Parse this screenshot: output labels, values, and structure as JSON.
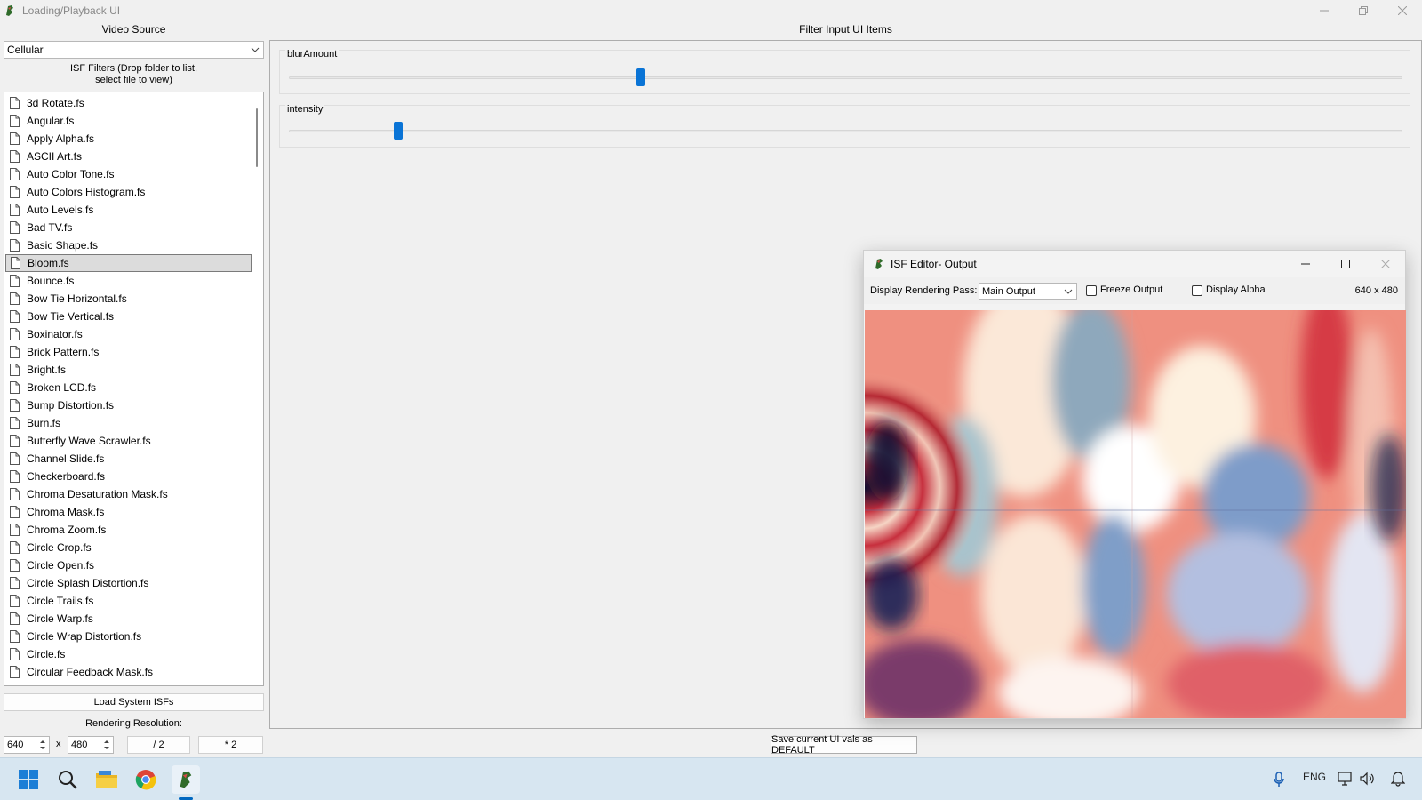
{
  "window": {
    "title": "Loading/Playback UI",
    "controls": [
      "minimize",
      "restore",
      "close"
    ]
  },
  "left_panel": {
    "video_source_label": "Video Source",
    "video_source_value": "Cellular",
    "filters_heading_line1": "ISF Filters (Drop folder to list,",
    "filters_heading_line2": "select file to view)",
    "files": [
      "3d Rotate.fs",
      "Angular.fs",
      "Apply Alpha.fs",
      "ASCII Art.fs",
      "Auto Color Tone.fs",
      "Auto Colors Histogram.fs",
      "Auto Levels.fs",
      "Bad TV.fs",
      "Basic Shape.fs",
      "Bloom.fs",
      "Bounce.fs",
      "Bow Tie Horizontal.fs",
      "Bow Tie Vertical.fs",
      "Boxinator.fs",
      "Brick Pattern.fs",
      "Bright.fs",
      "Broken LCD.fs",
      "Bump Distortion.fs",
      "Burn.fs",
      "Butterfly Wave Scrawler.fs",
      "Channel Slide.fs",
      "Checkerboard.fs",
      "Chroma Desaturation Mask.fs",
      "Chroma Mask.fs",
      "Chroma Zoom.fs",
      "Circle Crop.fs",
      "Circle Open.fs",
      "Circle Splash Distortion.fs",
      "Circle Trails.fs",
      "Circle Warp.fs",
      "Circle Wrap Distortion.fs",
      "Circle.fs",
      "Circular Feedback Mask.fs"
    ],
    "selected_file": "Bloom.fs",
    "load_button": "Load System ISFs",
    "resolution_label": "Rendering Resolution:",
    "width_value": "640",
    "x_label": "x",
    "height_value": "480",
    "half_button": "/ 2",
    "double_button": "* 2"
  },
  "filter_panel": {
    "heading": "Filter Input UI Items",
    "inputs": [
      {
        "name": "blurAmount",
        "level": 0.316
      },
      {
        "name": "intensity",
        "level": 0.098
      }
    ],
    "save_button": "Save current UI vals as DEFAULT"
  },
  "output_window": {
    "title": "ISF Editor- Output",
    "pass_label": "Display Rendering Pass:",
    "pass_value": "Main Output",
    "freeze_label": "Freeze Output",
    "alpha_label": "Display Alpha",
    "size_text": "640 x 480"
  },
  "taskbar": {
    "apps": [
      "start-icon",
      "search-icon",
      "file-explorer-icon",
      "chrome-icon",
      "isf-editor-icon"
    ],
    "language": "ENG"
  },
  "colors": {
    "accent": "#0a74d6",
    "selection": "#dcdcdc",
    "taskbar": "#d7e6f1"
  }
}
